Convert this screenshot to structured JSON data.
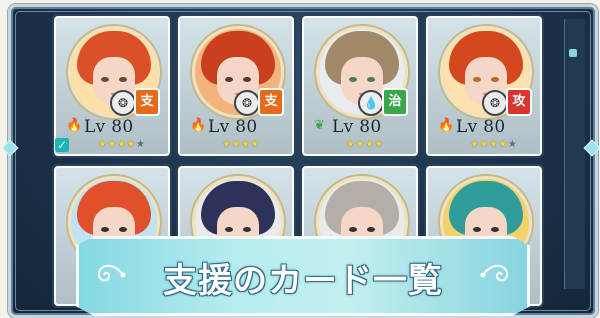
{
  "cards_row1": [
    {
      "level": "Lv 80",
      "role": "支",
      "role_color": "#e56a1c",
      "element_icon": "fire-emblem-icon",
      "stars_filled": 4,
      "stars_total": 5,
      "hair": "#d9502b",
      "bg": "#ffdfa8",
      "eye": "#6b4a2b",
      "checked": true
    },
    {
      "level": "Lv 80",
      "role": "支",
      "role_color": "#e56a1c",
      "element_icon": "fire-emblem-icon",
      "stars_filled": 4,
      "stars_total": 4,
      "hair": "#c8401e",
      "bg": "#f2b47c",
      "eye": "#5a3a2a",
      "checked": false
    },
    {
      "level": "Lv 80",
      "role": "治",
      "role_color": "#3ba64c",
      "element_icon": "water-drop-icon",
      "stars_filled": 4,
      "stars_total": 4,
      "hair": "#a08868",
      "bg": "#e9ecef",
      "eye": "#4e7c52",
      "checked": false
    },
    {
      "level": "Lv 80",
      "role": "攻",
      "role_color": "#d8362c",
      "element_icon": "fire-emblem-icon",
      "stars_filled": 4,
      "stars_total": 5,
      "hair": "#d4481f",
      "bg": "#ffe1b0",
      "eye": "#b86a2a",
      "checked": false
    }
  ],
  "cards_row2": [
    {
      "hair": "#e0502c",
      "bg": "#bfe3f2"
    },
    {
      "hair": "#2d3358",
      "bg": "#eaeaea"
    },
    {
      "hair": "#b4aea8",
      "bg": "#e8ece8"
    },
    {
      "hair": "#2f9e9a",
      "bg": "#f2d26c"
    }
  ],
  "banner": {
    "title": "支援のカード一覧"
  },
  "colors": {
    "panel": "#1c324a",
    "accent": "#88d6d8",
    "star": "#f3d341"
  }
}
